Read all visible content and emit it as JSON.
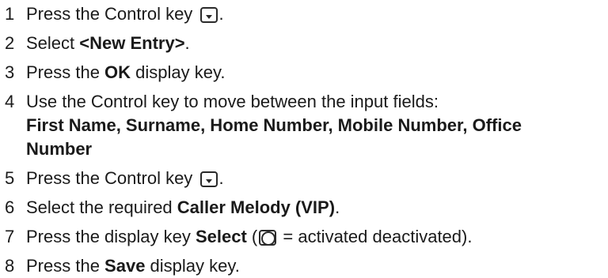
{
  "steps": [
    {
      "num": "1",
      "text_before": "Press the Control key ",
      "icon": "control-key-icon",
      "text_after": "."
    },
    {
      "num": "2",
      "text_before": "Select ",
      "bold": "<New Entry>",
      "text_after": "."
    },
    {
      "num": "3",
      "text_before": "Press the ",
      "bold": "OK",
      "text_after": " display key."
    },
    {
      "num": "4",
      "text": "Use the Control key to move between the input fields:",
      "fields_line1": "First Name, Surname, Home Number, Mobile Number, Office",
      "fields_line2": "Number"
    },
    {
      "num": "5",
      "text_before": "Press the Control key ",
      "icon": "control-key-icon",
      "text_after": "."
    },
    {
      "num": "6",
      "text_before": "Select the required ",
      "bold": "Caller Melody (VIP)",
      "text_after": "."
    },
    {
      "num": "7",
      "text_before": "Press the display key ",
      "bold": "Select",
      "text_mid": " (",
      "icon": "radio-selected-icon",
      "text_after": " = activated deactivated)."
    },
    {
      "num": "8",
      "text_before": "Press the ",
      "bold": "Save",
      "text_after": " display key."
    }
  ]
}
